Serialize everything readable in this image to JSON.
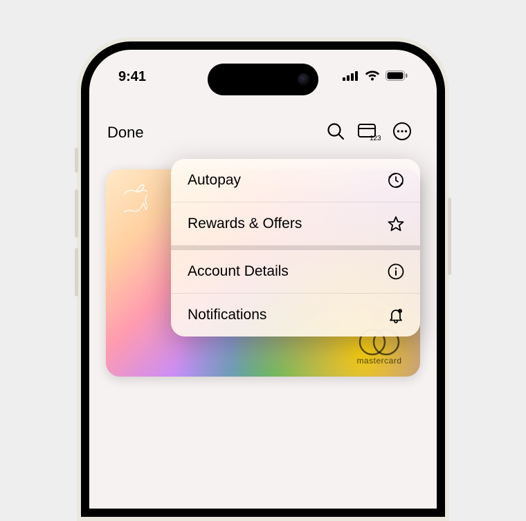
{
  "status": {
    "time": "9:41"
  },
  "toolbar": {
    "done": "Done"
  },
  "card": {
    "brand": "mastercard"
  },
  "menu": {
    "items": [
      {
        "label": "Autopay",
        "icon": "autopay-icon"
      },
      {
        "label": "Rewards & Offers",
        "icon": "star-icon"
      },
      {
        "label": "Account Details",
        "icon": "info-icon"
      },
      {
        "label": "Notifications",
        "icon": "bell-icon"
      }
    ]
  }
}
